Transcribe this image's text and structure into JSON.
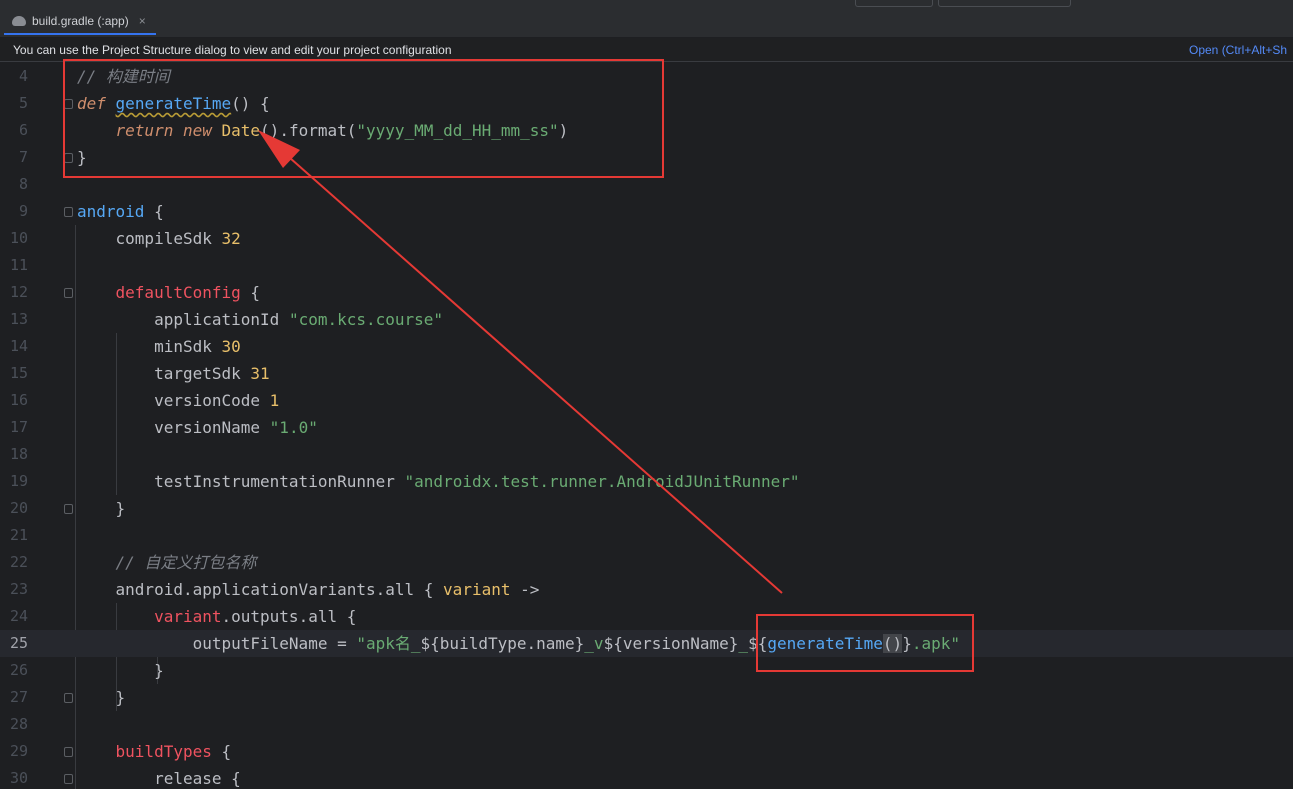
{
  "tab": {
    "title": "build.gradle (:app)",
    "close": "×",
    "icon": "gradle-elephant-icon"
  },
  "banner": {
    "message": "You can use the Project Structure dialog to view and edit your project configuration",
    "link": "Open (Ctrl+Alt+Sh"
  },
  "editor": {
    "current_line": 25,
    "lines": [
      {
        "n": "4"
      },
      {
        "n": "5"
      },
      {
        "n": "6"
      },
      {
        "n": "7"
      },
      {
        "n": "8"
      },
      {
        "n": "9"
      },
      {
        "n": "10"
      },
      {
        "n": "11"
      },
      {
        "n": "12"
      },
      {
        "n": "13"
      },
      {
        "n": "14"
      },
      {
        "n": "15"
      },
      {
        "n": "16"
      },
      {
        "n": "17"
      },
      {
        "n": "18"
      },
      {
        "n": "19"
      },
      {
        "n": "20"
      },
      {
        "n": "21"
      },
      {
        "n": "22"
      },
      {
        "n": "23"
      },
      {
        "n": "24"
      },
      {
        "n": "25"
      },
      {
        "n": "26"
      },
      {
        "n": "27"
      },
      {
        "n": "28"
      },
      {
        "n": "29"
      },
      {
        "n": "30"
      }
    ],
    "code": {
      "l4_comment": "// 构建时间",
      "l5_def": "def",
      "l5_name": "generateTime",
      "l5_rest": "() {",
      "l6_return": "return",
      "l6_new": "new",
      "l6_class": "Date",
      "l6_call": "().format(",
      "l6_str": "\"yyyy_MM_dd_HH_mm_ss\"",
      "l6_close": ")",
      "l7": "}",
      "l9_block": "android",
      "l9_brace": " {",
      "l10_key": "compileSdk",
      "l10_val": "32",
      "l12_block": "defaultConfig",
      "l12_brace": " {",
      "l13_key": "applicationId",
      "l13_val": "\"com.kcs.course\"",
      "l14_key": "minSdk",
      "l14_val": "30",
      "l15_key": "targetSdk",
      "l15_val": "31",
      "l16_key": "versionCode",
      "l16_val": "1",
      "l17_key": "versionName",
      "l17_val": "\"1.0\"",
      "l19_key": "testInstrumentationRunner",
      "l19_val": "\"androidx.test.runner.AndroidJUnitRunner\"",
      "l20": "}",
      "l22_comment": "// 自定义打包名称",
      "l23_a": "android.applicationVariants.all { ",
      "l23_var": "variant",
      "l23_arrow": " ->",
      "l24_var": "variant",
      "l24_rest": ".outputs.all {",
      "l25_key": "outputFileName = ",
      "l25_s1": "\"apk名_",
      "l25_t1": "${buildType.name}",
      "l25_s2": "_v",
      "l25_t2": "${versionName}",
      "l25_s3": "_",
      "l25_t3a": "${",
      "l25_fn": "generateTime",
      "l25_paren": "()",
      "l25_t3b": "}",
      "l25_s4": ".apk\"",
      "l26": "}",
      "l27": "}",
      "l29_block": "buildTypes",
      "l29_brace": " {",
      "l30_block": "release",
      "l30_brace": " {"
    }
  },
  "annotation": {
    "box_color": "#e53935",
    "arrow_color": "#e53935"
  }
}
